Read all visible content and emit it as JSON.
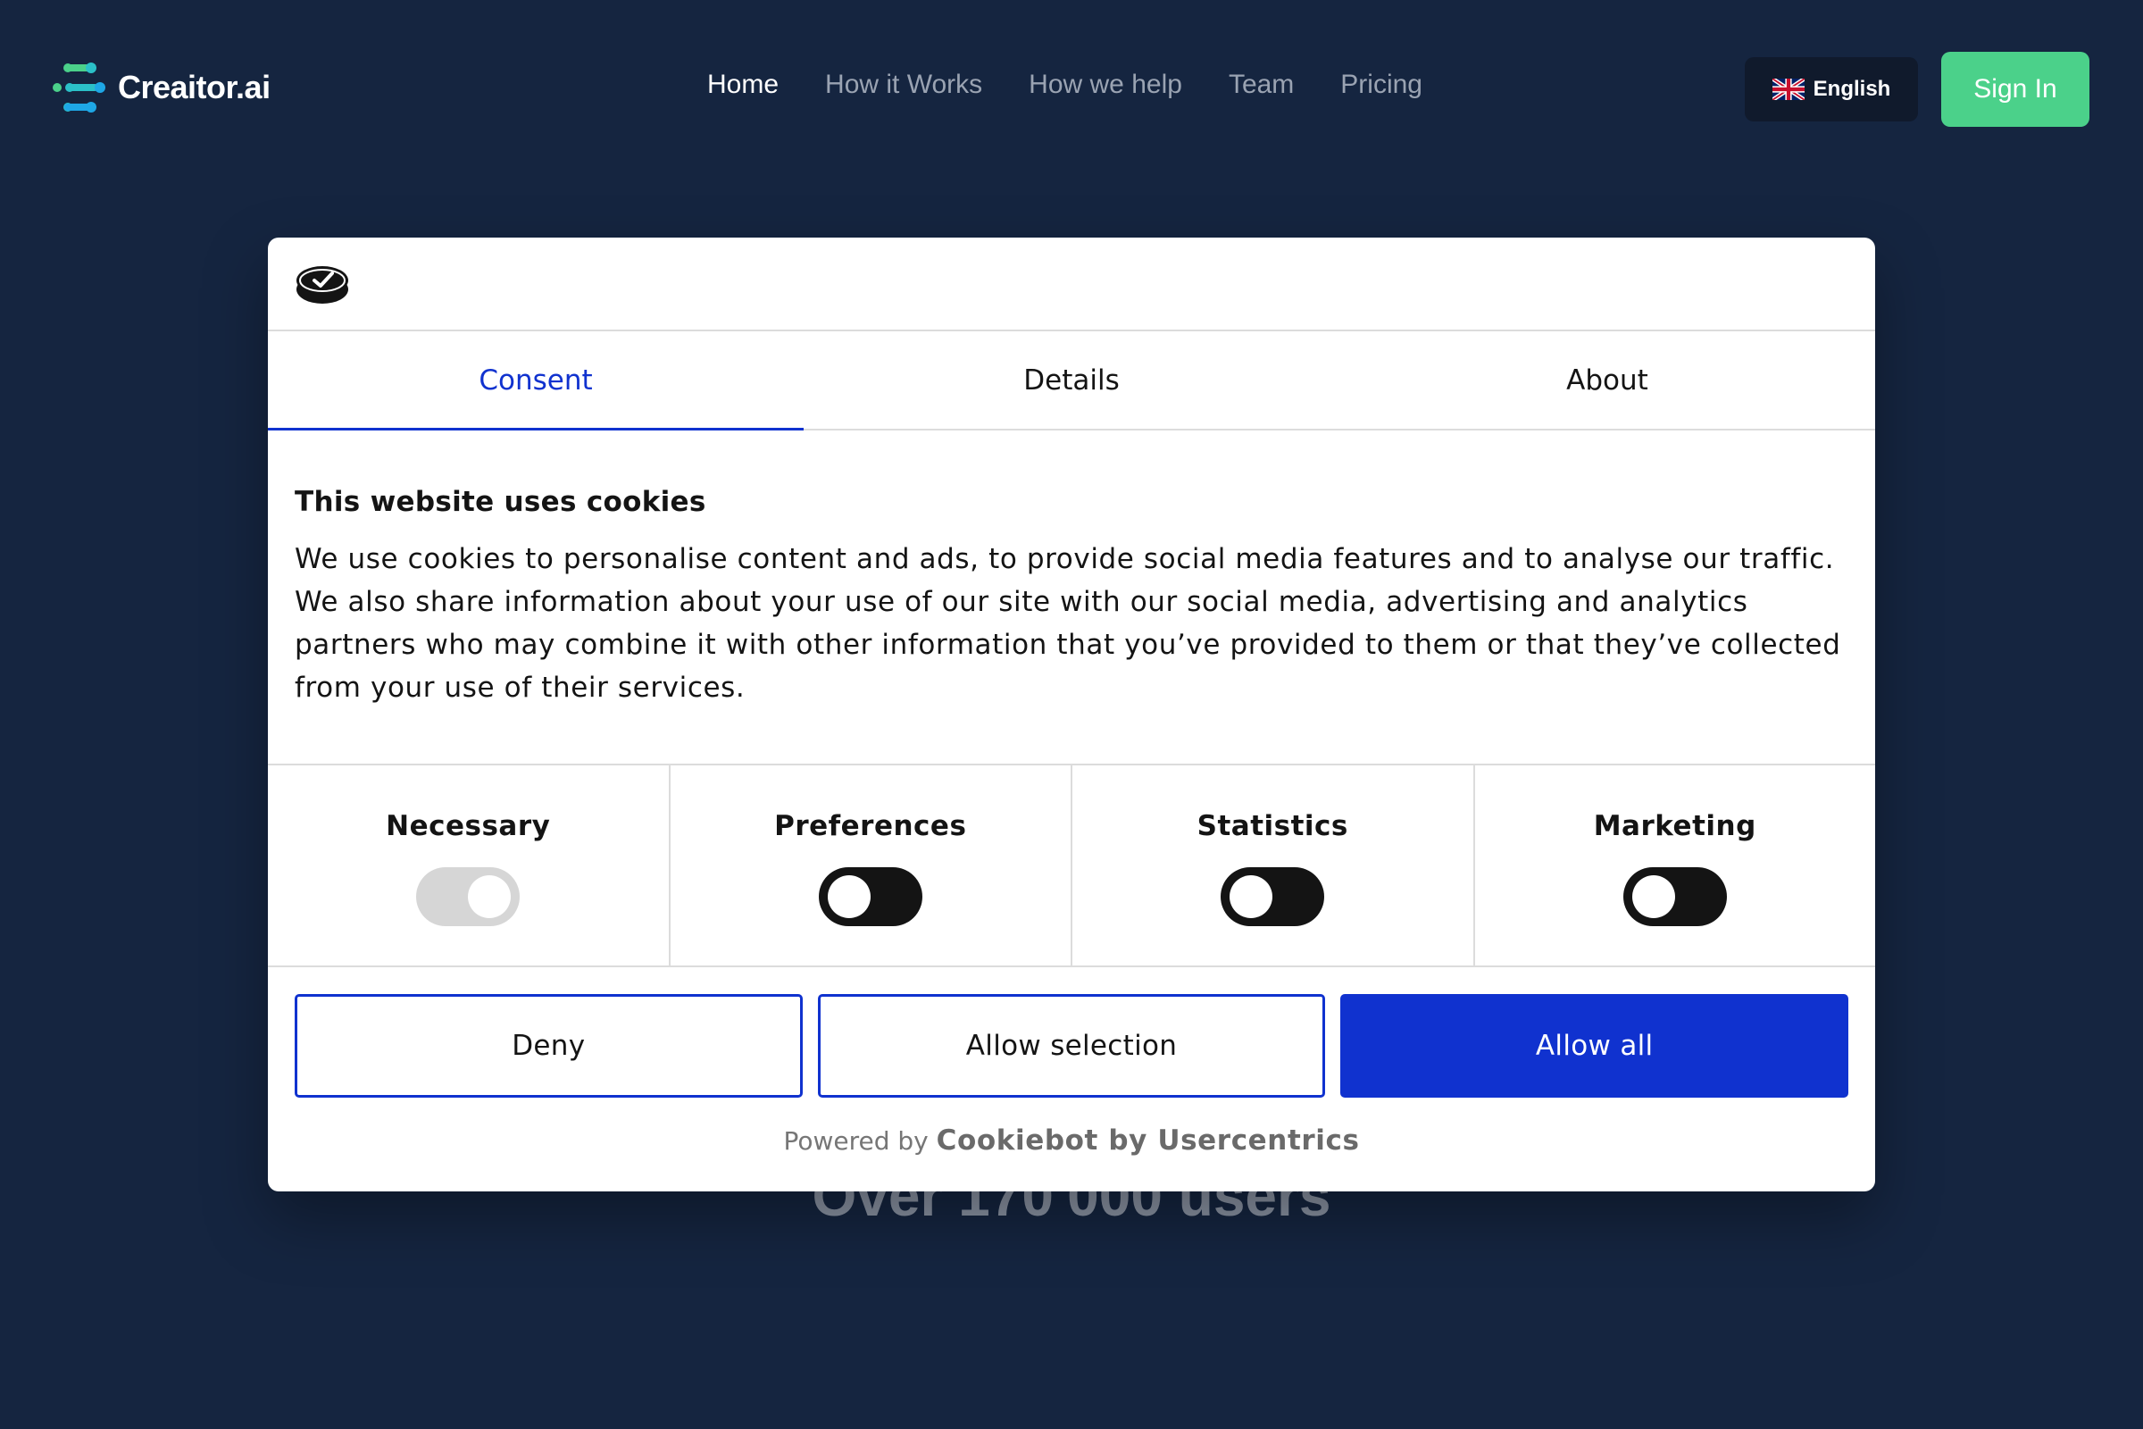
{
  "header": {
    "brand": "Creaitor.ai",
    "nav": [
      "Home",
      "How it Works",
      "How we help",
      "Team",
      "Pricing"
    ],
    "language": "English",
    "signin": "Sign In"
  },
  "hero": {
    "users_text": "Over 170'000 users"
  },
  "cookie_dialog": {
    "tabs": [
      "Consent",
      "Details",
      "About"
    ],
    "active_tab": "Consent",
    "heading": "This website uses cookies",
    "body": "We use cookies to personalise content and ads, to provide social media features and to analyse our traffic. We also share information about your use of our site with our social media, advertising and analytics partners who may combine it with other information that you’ve provided to them or that they’ve collected from your use of their services.",
    "toggles": [
      {
        "label": "Necessary",
        "state": "on-disabled"
      },
      {
        "label": "Preferences",
        "state": "off"
      },
      {
        "label": "Statistics",
        "state": "off"
      },
      {
        "label": "Marketing",
        "state": "off"
      }
    ],
    "buttons": {
      "deny": "Deny",
      "allow_selection": "Allow selection",
      "allow_all": "Allow all"
    },
    "powered_prefix": "Powered by",
    "powered_brand": "Cookiebot by Usercentrics"
  },
  "colors": {
    "page_bg": "#152540",
    "accent_green": "#4bd18a",
    "dialog_blue": "#1032cf"
  }
}
